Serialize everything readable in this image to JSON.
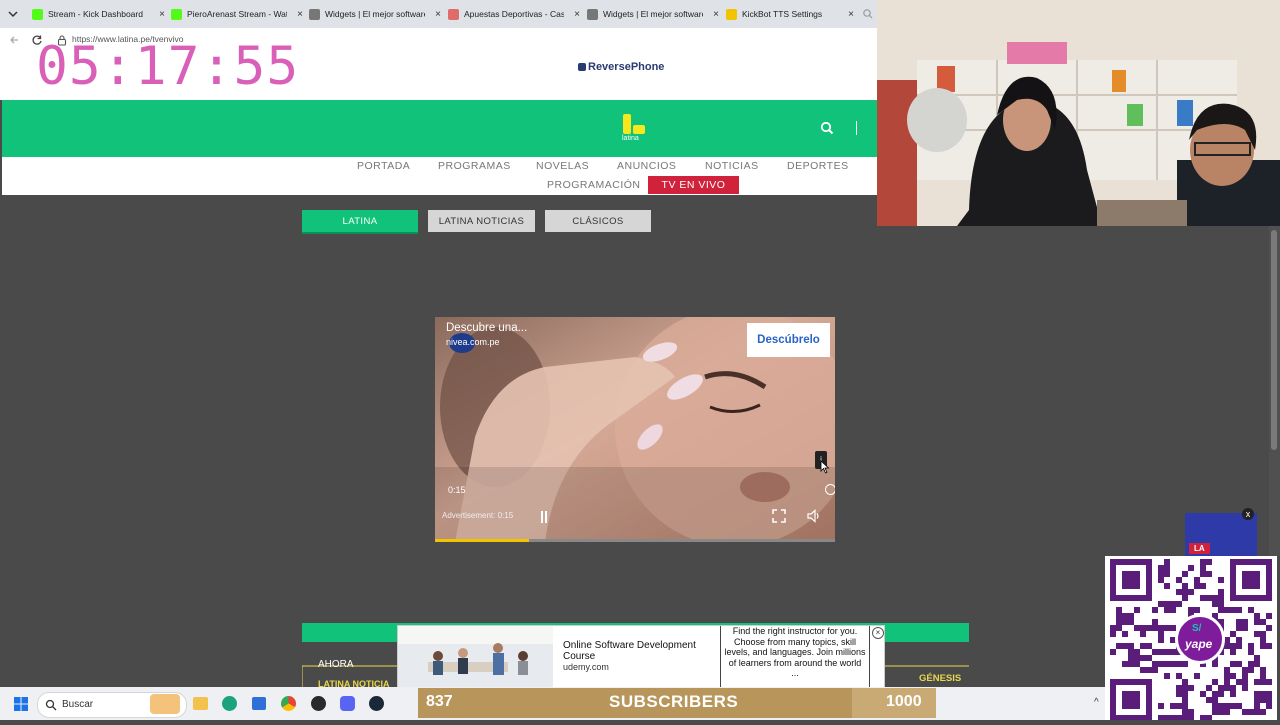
{
  "browser": {
    "tabs": [
      {
        "title": "Stream - Kick Dashboard",
        "favicon_color": "#53fc18"
      },
      {
        "title": "PieroArenast Stream - Watch",
        "favicon_color": "#53fc18"
      },
      {
        "title": "Widgets | El mejor software",
        "favicon_color": "#777777"
      },
      {
        "title": "Apuestas Deportivas - Casa",
        "favicon_color": "#e06b6b"
      },
      {
        "title": "Widgets | El mejor software",
        "favicon_color": "#777777"
      },
      {
        "title": "KickBot TTS Settings",
        "favicon_color": "#f2c300"
      }
    ],
    "close_glyph": "×",
    "url": "https://www.latina.pe/tvenvivo"
  },
  "overlay": {
    "clock": "05:17:55",
    "subscribers_count": "837",
    "subscribers_label": "SUBSCRIBERS",
    "subscribers_goal": "1000",
    "subscribers_progress": 0.837
  },
  "site": {
    "sponsor": "ReversePhone",
    "logo_text": "latina",
    "nav": {
      "row1": [
        "PORTADA",
        "PROGRAMAS",
        "NOVELAS",
        "ANUNCIOS",
        "NOTICIAS",
        "DEPORTES"
      ],
      "row2_left": "PROGRAMACIÓN",
      "row2_active": "TV EN VIVO"
    },
    "channels": [
      {
        "label": "LATINA",
        "active": true
      },
      {
        "label": "LATINA NOTICIAS",
        "active": false
      },
      {
        "label": "CLÁSICOS",
        "active": false
      }
    ],
    "ticker": {
      "now_label": "AHORA",
      "left_program": "LATINA NOTICIA",
      "right_program": "GÉNESIS"
    },
    "brand_color": "#11c27a",
    "live_color": "#d0223a"
  },
  "video": {
    "ad_title": "Descubre una...",
    "ad_domain": "nivea.com.pe",
    "cta": "Descúbrelo",
    "time": "0:15",
    "ad_label": "Advertisement: 0:15",
    "info_badge": "i",
    "progress": 0.235
  },
  "banner_ad": {
    "title": "Online Software Development Course",
    "domain": "udemy.com",
    "description": "Find the right instructor for you. Choose from many topics, skill levels, and languages. Join millions of learners from around the world ...",
    "close_glyph": "×"
  },
  "mini_player": {
    "label": "LA",
    "close_glyph": "x"
  },
  "qr": {
    "label": "yape",
    "currency": "S/"
  },
  "taskbar": {
    "search_placeholder": "Buscar",
    "tray_arrow": "^"
  }
}
